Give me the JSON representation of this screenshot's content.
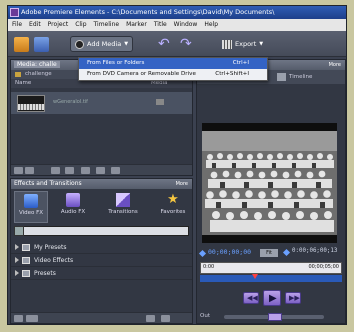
{
  "window": {
    "title": "Adobe Premiere Elements - C:\\Documents and Settings\\David\\My Documents\\"
  },
  "menu": [
    "File",
    "Edit",
    "Project",
    "Clip",
    "Timeline",
    "Marker",
    "Title",
    "Window",
    "Help"
  ],
  "toolbar": {
    "add_media_label": "Add Media",
    "export_label": "Export"
  },
  "dropdown": {
    "items": [
      {
        "label": "From Files or Folders",
        "shortcut": "Ctrl+I"
      },
      {
        "label": "From DVD Camera or Removable Drive",
        "shortcut": "Ctrl+Shift+I"
      }
    ]
  },
  "media_panel": {
    "tab_label": "Media: challe",
    "folder_label": "challenge",
    "col_name": "Name",
    "col_media": "Media",
    "clip_name": "wGeneralol.tif"
  },
  "effects_panel": {
    "title": "Effects and Transitions",
    "more_label": "More",
    "tabs": [
      {
        "label": "Video FX",
        "icon": "video-fx-icon"
      },
      {
        "label": "Audio FX",
        "icon": "audio-fx-icon"
      },
      {
        "label": "Transitions",
        "icon": "transitions-icon"
      },
      {
        "label": "Favorites",
        "icon": "favorites-star-icon"
      }
    ],
    "items": [
      "My Presets",
      "Video Effects",
      "Presets"
    ]
  },
  "monitor": {
    "more_label": "More",
    "timeline_label": "Timeline",
    "current_time": "00;00;00;00",
    "fit_label": "Fit",
    "duration": "0:00;06;00;13",
    "scrub_start": "0:00",
    "scrub_end": "00;00;05;00",
    "out_label": "Out"
  },
  "colors": {
    "accent": "#3463c4",
    "panel_bg": "#323743",
    "timecode": "#6aa0ff"
  }
}
